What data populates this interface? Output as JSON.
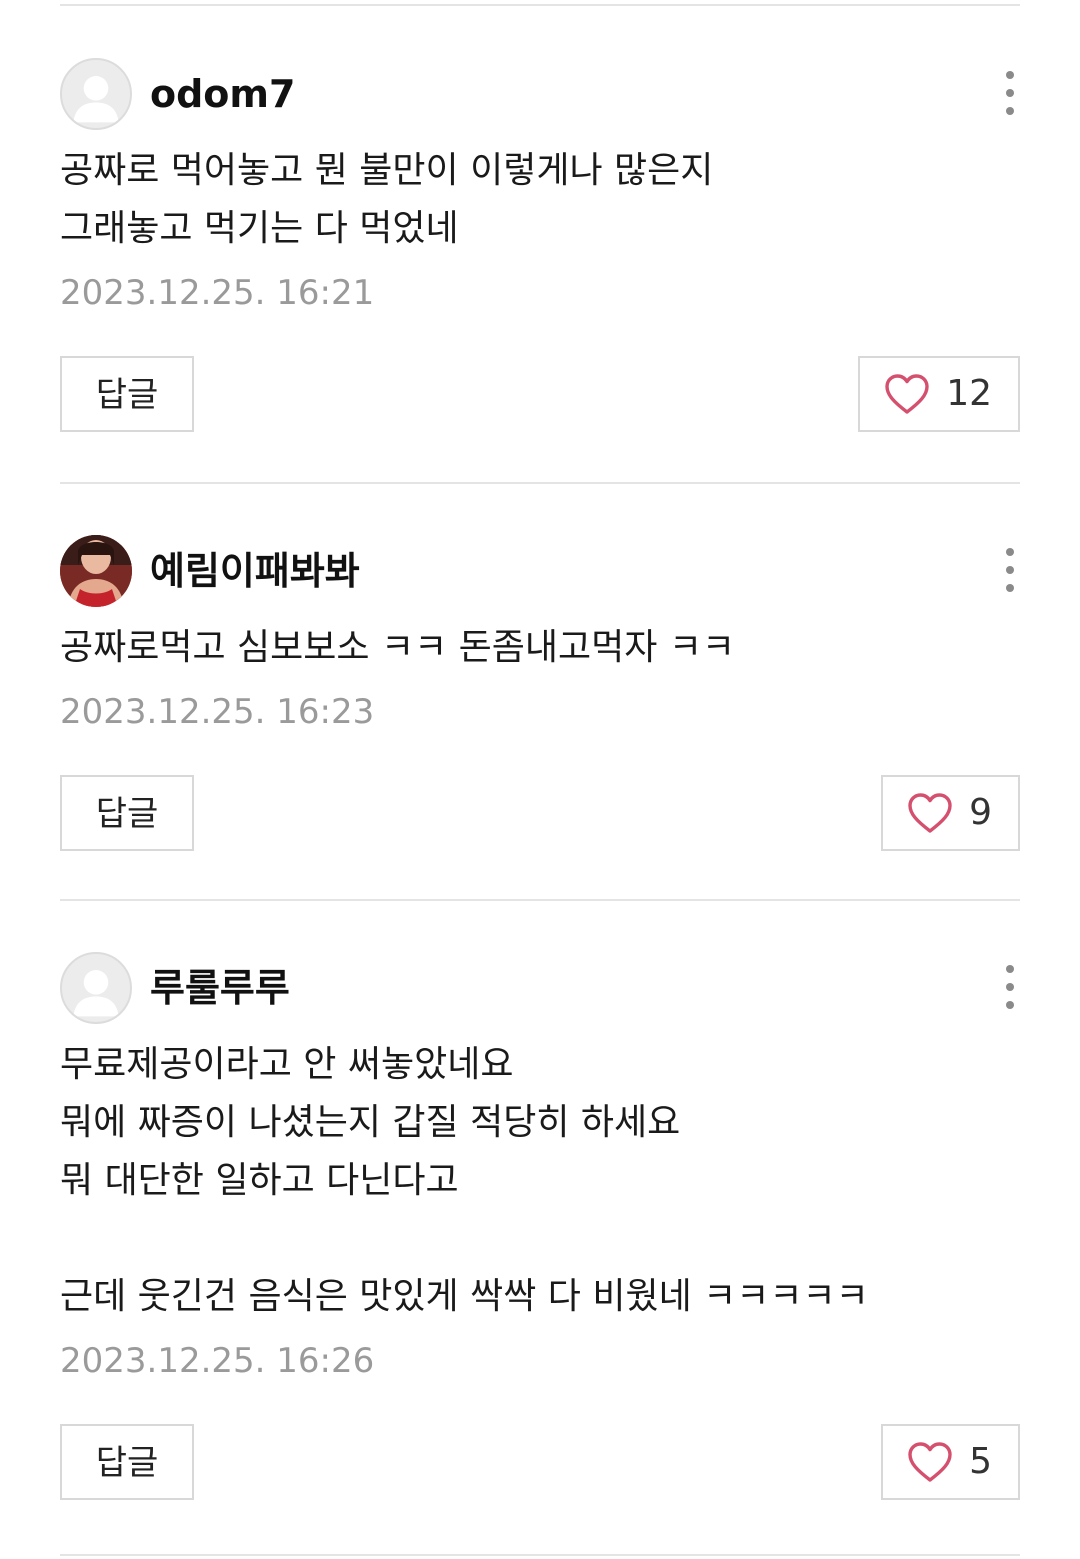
{
  "comments": [
    {
      "author": "odom7",
      "avatar": "default-avatar",
      "body": "공짜로 먹어놓고 뭔 불만이 이렇게나 많은지\n그래놓고 먹기는 다 먹었네",
      "timestamp": "2023.12.25. 16:21",
      "reply_label": "답글",
      "like_count": "12"
    },
    {
      "author": "예림이패봐봐",
      "avatar": "photo-avatar",
      "body": "공짜로먹고 심보보소 ㅋㅋ 돈좀내고먹자 ㅋㅋ",
      "timestamp": "2023.12.25. 16:23",
      "reply_label": "답글",
      "like_count": "9"
    },
    {
      "author": "루룰루루",
      "avatar": "default-avatar",
      "body": "무료제공이라고 안 써놓았네요\n뭐에 짜증이 나셨는지 갑질 적당히 하세요\n뭐 대단한 일하고 다닌다고\n\n근데 웃긴건 음식은 맛있게 싹싹 다 비웠네 ㅋㅋㅋㅋㅋ",
      "timestamp": "2023.12.25. 16:26",
      "reply_label": "답글",
      "like_count": "5"
    }
  ],
  "icons": {
    "more": "vertical-dots-icon",
    "like": "heart-outline-icon"
  },
  "colors": {
    "heart": "#d4506e",
    "timestamp": "#9a9a9a",
    "divider": "#e4e4e4",
    "border": "#d8d8d8"
  }
}
